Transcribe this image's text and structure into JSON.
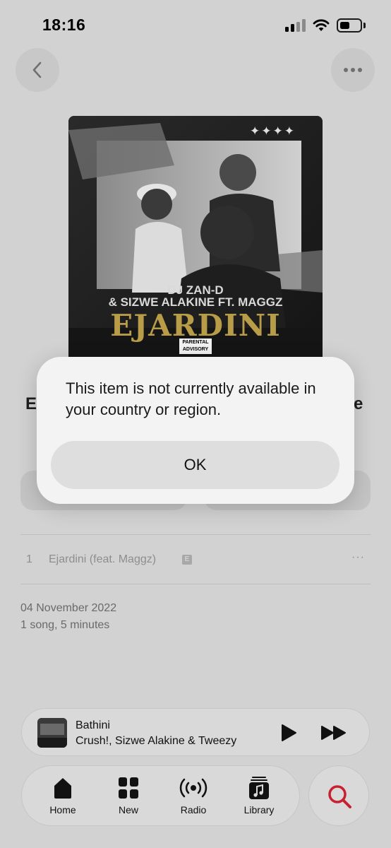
{
  "status_bar": {
    "time": "18:16"
  },
  "header": {
    "back_icon": "chevron-left-icon",
    "more_icon": "ellipsis-icon"
  },
  "artwork": {
    "stars": "✦✦✦✦",
    "artist_line1": "DJ ZAN-D",
    "artist_line2": "& SIZWE ALAKINE FT. MAGGZ",
    "title": "EJARDINI",
    "advisory": "PARENTAL ADVISORY"
  },
  "album": {
    "title_left_fragment": "E",
    "title_right_fragment": "e"
  },
  "tracks": [
    {
      "number": "1",
      "title": "Ejardini (feat. Maggz)",
      "explicit": "E",
      "more": "···"
    }
  ],
  "release": {
    "date": "04 November 2022",
    "info": "1 song, 5 minutes"
  },
  "mini_player": {
    "title": "Bathini",
    "artist": "Crush!, Sizwe Alakine & Tweezy"
  },
  "tab_bar": {
    "tabs": [
      {
        "label": "Home",
        "icon": "home-icon"
      },
      {
        "label": "New",
        "icon": "grid-icon"
      },
      {
        "label": "Radio",
        "icon": "radio-icon"
      },
      {
        "label": "Library",
        "icon": "library-icon"
      }
    ],
    "search_icon": "search-icon"
  },
  "alert": {
    "message": "This item is not currently available in your country or region.",
    "ok_label": "OK"
  },
  "colors": {
    "accent": "#c8202f",
    "alert_background": "#f3f3f3",
    "screen_dim": "#d2d2d2"
  }
}
